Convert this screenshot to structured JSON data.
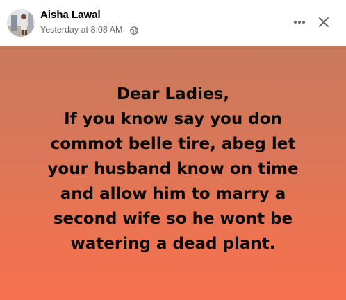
{
  "post": {
    "author_name": "Aisha Lawal",
    "timestamp": "Yesterday at 8:08 AM",
    "separator": "·",
    "privacy_icon": "globe-icon",
    "more_icon": "more-dots-icon",
    "close_icon": "close-icon",
    "text": "Dear Ladies,\nIf you know say you don\ncommot belle tire, abeg let\nyour husband know on time\nand allow him to marry a\nsecond wife so he wont be\nwatering a dead plant.",
    "background_colors": {
      "top": "#c9795b",
      "bottom": "#f7714e"
    },
    "text_color": "#0a0a0a"
  }
}
